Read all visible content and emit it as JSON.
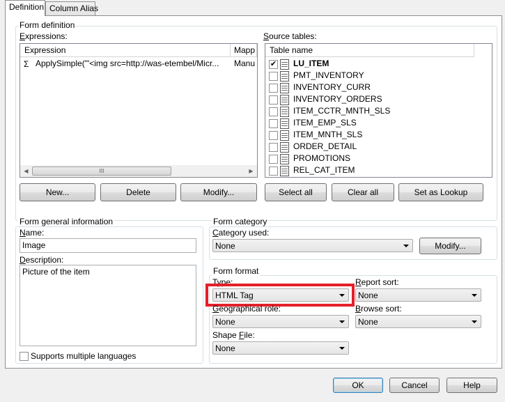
{
  "tabs": [
    {
      "label": "Definition"
    },
    {
      "label": "Column Alias"
    }
  ],
  "form_definition": {
    "title": "Form definition",
    "expressions_label": "Expressions:",
    "expressions_columns": [
      "Expression",
      "Mapp"
    ],
    "expressions_rows": [
      {
        "expression": "ApplySimple(\"'<img src=http://was-etembel/Micr...",
        "mapping": "Manu"
      }
    ],
    "scroll_thumb_glyph": "III",
    "source_tables_label": "Source tables:",
    "source_tables_column": "Table name",
    "source_tables": [
      {
        "name": "LU_ITEM",
        "checked": true,
        "bold": true,
        "check_glyph": "✔"
      },
      {
        "name": "PMT_INVENTORY",
        "checked": false
      },
      {
        "name": "INVENTORY_CURR",
        "checked": false
      },
      {
        "name": "INVENTORY_ORDERS",
        "checked": false
      },
      {
        "name": "ITEM_CCTR_MNTH_SLS",
        "checked": false
      },
      {
        "name": "ITEM_EMP_SLS",
        "checked": false
      },
      {
        "name": "ITEM_MNTH_SLS",
        "checked": false
      },
      {
        "name": "ORDER_DETAIL",
        "checked": false
      },
      {
        "name": "PROMOTIONS",
        "checked": false
      },
      {
        "name": "REL_CAT_ITEM",
        "checked": false
      }
    ],
    "buttons": {
      "new": "New...",
      "delete": "Delete",
      "modify": "Modify...",
      "select_all": "Select all",
      "clear_all": "Clear all",
      "set_as_lookup": "Set as Lookup"
    }
  },
  "general_info": {
    "title": "Form general information",
    "name_label": "Name:",
    "name_value": "Image",
    "description_label": "Description:",
    "description_value": "Picture of the item",
    "multi_lang_label": "Supports multiple languages"
  },
  "form_category": {
    "title": "Form category",
    "category_used_label": "Category used:",
    "category_used_value": "None",
    "modify_button": "Modify..."
  },
  "form_format": {
    "title": "Form format",
    "type_label": "Type:",
    "type_value": "HTML Tag",
    "report_sort_label": "Report sort:",
    "report_sort_value": "None",
    "geo_role_label": "Geographical role:",
    "geo_role_value": "None",
    "browse_sort_label": "Browse sort:",
    "browse_sort_value": "None",
    "shape_file_label": "Shape File:",
    "shape_file_value": "None",
    "highlight_color": "#e3202a"
  },
  "dialog_buttons": {
    "ok": "OK",
    "cancel": "Cancel",
    "help": "Help"
  }
}
